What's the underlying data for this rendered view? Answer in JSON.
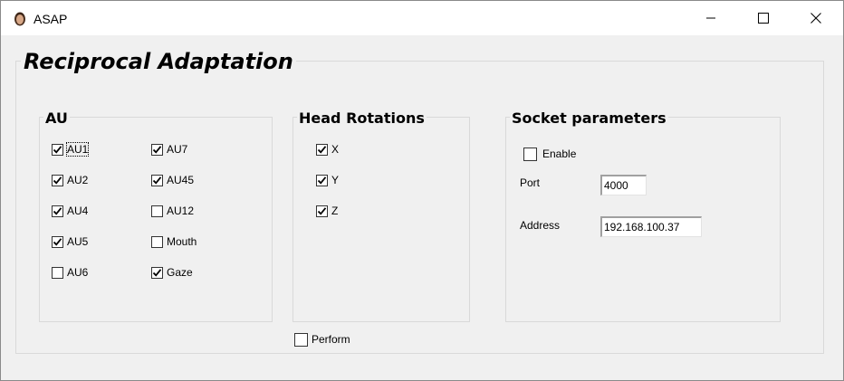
{
  "window": {
    "title": "ASAP",
    "icon": "avatar-icon"
  },
  "main": {
    "title": "Reciprocal Adaptation"
  },
  "au": {
    "title": "AU",
    "items": [
      {
        "label": "AU1",
        "checked": true
      },
      {
        "label": "AU2",
        "checked": true
      },
      {
        "label": "AU4",
        "checked": true
      },
      {
        "label": "AU5",
        "checked": true
      },
      {
        "label": "AU6",
        "checked": false
      },
      {
        "label": "AU7",
        "checked": true
      },
      {
        "label": "AU45",
        "checked": true
      },
      {
        "label": "AU12",
        "checked": false
      },
      {
        "label": "Mouth",
        "checked": false
      },
      {
        "label": "Gaze",
        "checked": true
      }
    ]
  },
  "head_rotations": {
    "title": "Head Rotations",
    "items": [
      {
        "label": "X",
        "checked": true
      },
      {
        "label": "Y",
        "checked": true
      },
      {
        "label": "Z",
        "checked": true
      }
    ]
  },
  "socket": {
    "title": "Socket parameters",
    "enable": {
      "label": "Enable",
      "checked": false
    },
    "port": {
      "label": "Port",
      "value": "4000"
    },
    "address": {
      "label": "Address",
      "value": "192.168.100.37"
    }
  },
  "perform": {
    "label": "Perform",
    "checked": false
  }
}
